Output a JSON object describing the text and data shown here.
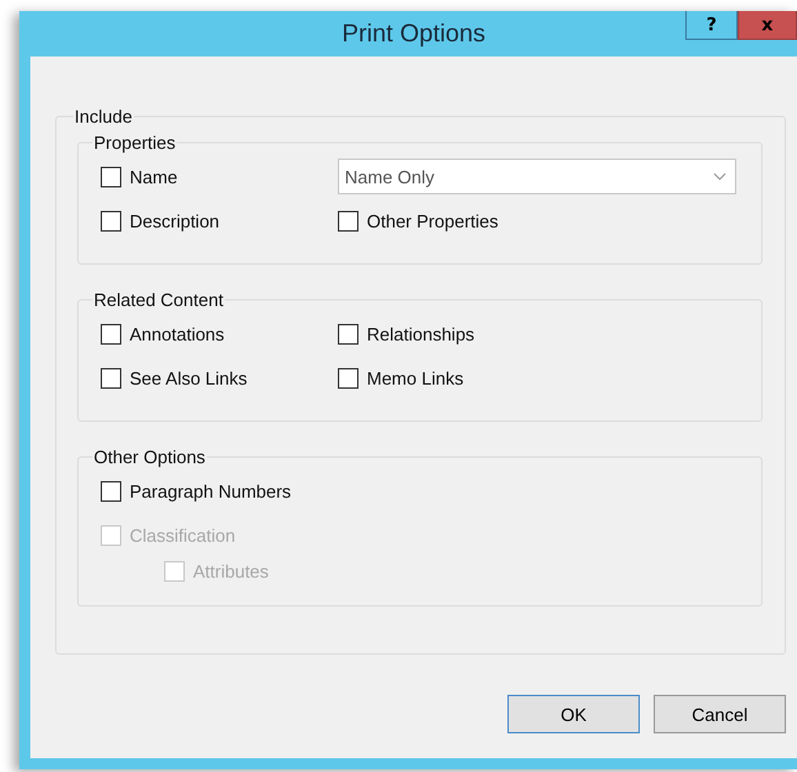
{
  "window": {
    "title": "Print Options",
    "help_button": "?",
    "close_button": "x"
  },
  "include": {
    "label": "Include",
    "groups": [
      {
        "label": "Properties",
        "rows": [
          [
            {
              "kind": "checkbox",
              "label": "Name",
              "checked": false,
              "disabled": false
            },
            {
              "kind": "dropdown",
              "value": "Name Only"
            }
          ],
          [
            {
              "kind": "checkbox",
              "label": "Description",
              "checked": false,
              "disabled": false
            },
            {
              "kind": "checkbox",
              "label": "Other Properties",
              "checked": false,
              "disabled": false
            }
          ]
        ]
      },
      {
        "label": "Related Content",
        "rows": [
          [
            {
              "kind": "checkbox",
              "label": "Annotations",
              "checked": false,
              "disabled": false
            },
            {
              "kind": "checkbox",
              "label": "Relationships",
              "checked": false,
              "disabled": false
            }
          ],
          [
            {
              "kind": "checkbox",
              "label": "See Also Links",
              "checked": false,
              "disabled": false
            },
            {
              "kind": "checkbox",
              "label": "Memo Links",
              "checked": false,
              "disabled": false
            }
          ]
        ]
      },
      {
        "label": "Other Options",
        "rows": [
          [
            {
              "kind": "checkbox",
              "label": "Paragraph Numbers",
              "checked": false,
              "disabled": false
            }
          ],
          [
            {
              "kind": "checkbox",
              "label": "Classification",
              "checked": false,
              "disabled": true,
              "children": [
                {
                  "kind": "checkbox",
                  "label": "Attributes",
                  "checked": false,
                  "disabled": true
                }
              ]
            }
          ]
        ]
      }
    ]
  },
  "buttons": [
    {
      "label": "OK",
      "default": true
    },
    {
      "label": "Cancel",
      "default": false
    }
  ]
}
